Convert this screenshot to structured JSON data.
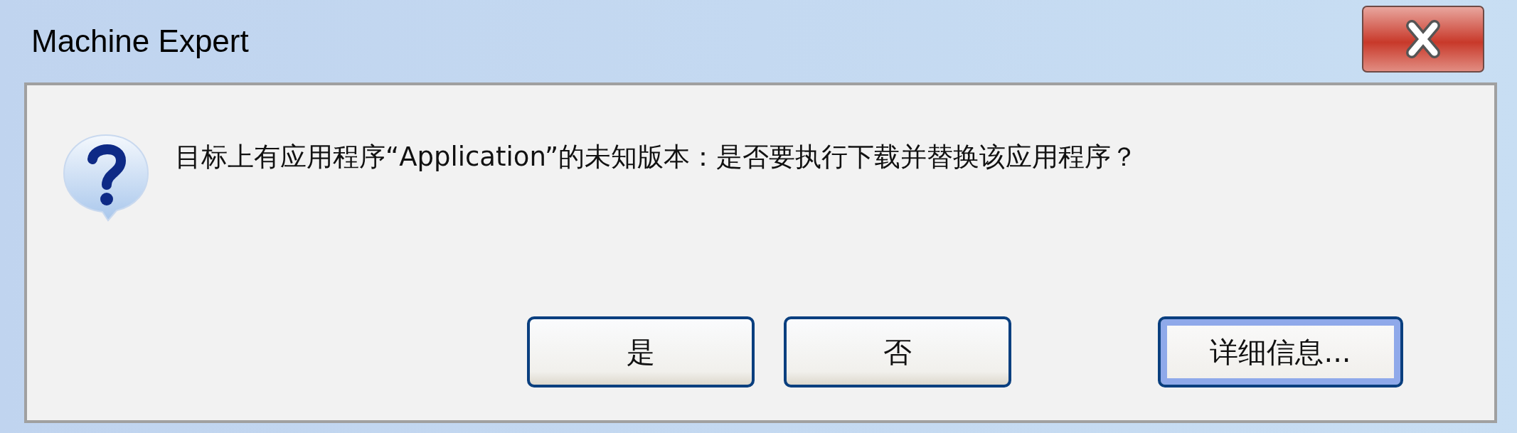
{
  "window": {
    "title": "Machine Expert"
  },
  "message": "目标上有应用程序“Application”的未知版本：是否要执行下载并替换该应用程序？",
  "buttons": [
    {
      "label": "是",
      "default": false
    },
    {
      "label": "否",
      "default": false
    },
    {
      "label": "详细信息...",
      "default": true
    }
  ]
}
